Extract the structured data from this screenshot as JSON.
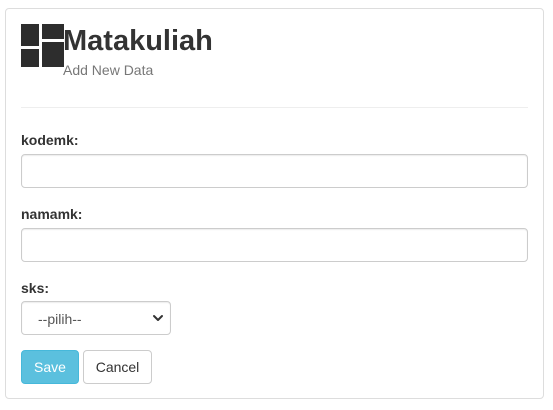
{
  "header": {
    "title": "Matakuliah",
    "subtitle": "Add New Data",
    "logo_icon": "grid-logo-icon"
  },
  "form": {
    "kodemk": {
      "label": "kodemk:",
      "value": "",
      "placeholder": ""
    },
    "namamk": {
      "label": "namamk:",
      "value": "",
      "placeholder": ""
    },
    "sks": {
      "label": "sks:",
      "selected": "--pilih--"
    }
  },
  "actions": {
    "save_label": "Save",
    "cancel_label": "Cancel"
  },
  "colors": {
    "save_bg": "#5bc0de",
    "title_text": "#333333",
    "subtitle_text": "#777777"
  }
}
